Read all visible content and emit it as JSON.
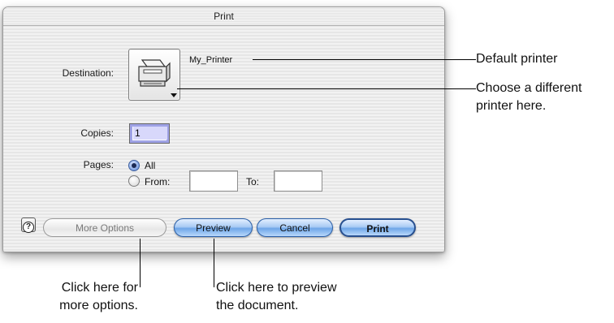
{
  "dialog": {
    "title": "Print",
    "destination_label": "Destination:",
    "printer_name": "My_Printer",
    "copies_label": "Copies:",
    "copies_value": "1",
    "pages_label": "Pages:",
    "pages_all_label": "All",
    "pages_from_label": "From:",
    "pages_to_label": "To:",
    "pages_selected": "All",
    "help_icon": "question-mark-icon",
    "buttons": {
      "more_options": "More Options",
      "preview": "Preview",
      "cancel": "Cancel",
      "print": "Print"
    }
  },
  "callouts": {
    "default_printer": "Default printer",
    "choose_printer_line1": "Choose a different",
    "choose_printer_line2": "printer here.",
    "more_options_line1": "Click here for",
    "more_options_line2": "more options.",
    "preview_line1": "Click here to preview",
    "preview_line2": "the document."
  },
  "colors": {
    "accent_blue": "#6ea6e8",
    "copies_focus": "#9fa2e6"
  }
}
